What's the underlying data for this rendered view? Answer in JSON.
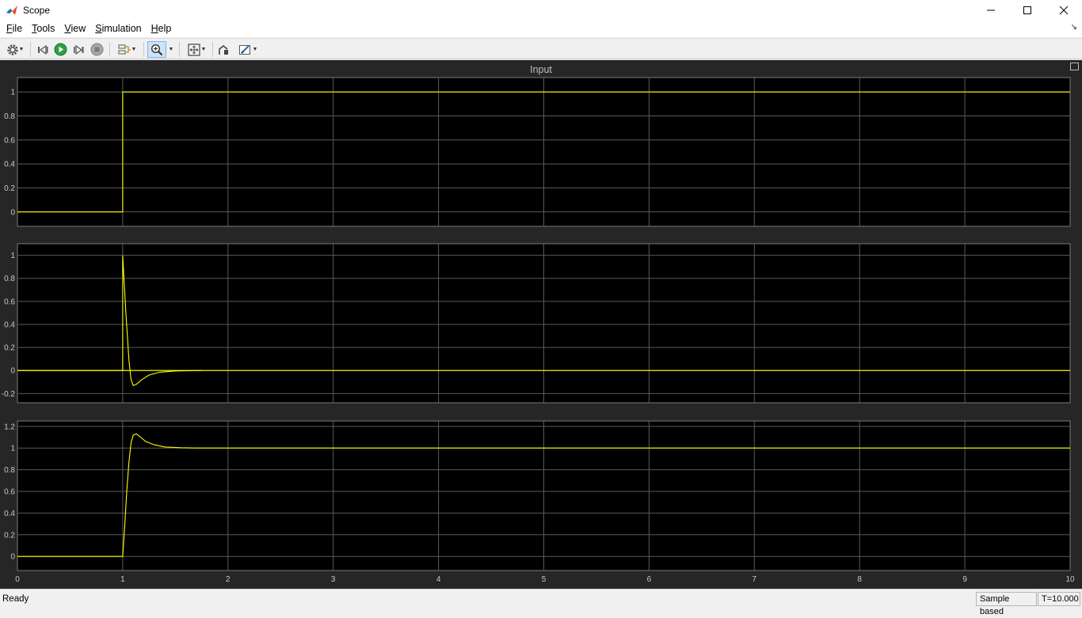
{
  "window": {
    "title": "Scope",
    "icon": "matlab-icon",
    "controls": [
      "minimize-icon",
      "maximize-icon",
      "close-icon"
    ]
  },
  "menu": {
    "items": [
      {
        "label": "File",
        "mnemonic": "F",
        "rest": "ile"
      },
      {
        "label": "Tools",
        "mnemonic": "T",
        "rest": "ools"
      },
      {
        "label": "View",
        "mnemonic": "V",
        "rest": "iew"
      },
      {
        "label": "Simulation",
        "mnemonic": "S",
        "rest": "imulation"
      },
      {
        "label": "Help",
        "mnemonic": "H",
        "rest": "elp"
      }
    ],
    "undock_glyph": "↘"
  },
  "toolbar": {
    "buttons": [
      "settings-icon",
      "step-back-icon",
      "run-icon",
      "step-forward-icon",
      "stop-icon",
      "signal-selection-icon",
      "zoom-in-icon",
      "fit-to-view-icon",
      "highlight-block-icon",
      "style-icon"
    ],
    "active_tool": "zoom-in-icon",
    "colors": {
      "run": "#2ea043",
      "stop": "#8c8c8c"
    }
  },
  "scope": {
    "title": "Input",
    "background": "#262626",
    "axes_background": "#000000",
    "trace_color": "#ffff00",
    "grid_color": "#5a5a5a",
    "x_ticks": [
      "0",
      "1",
      "2",
      "3",
      "4",
      "5",
      "6",
      "7",
      "8",
      "9",
      "10"
    ]
  },
  "chart_data": [
    {
      "type": "line",
      "xlim": [
        0,
        10
      ],
      "ylim": [
        -0.12,
        1.12
      ],
      "yticks": [
        0,
        0.2,
        0.4,
        0.6,
        0.8,
        1
      ],
      "ytick_labels": [
        "0",
        "0.2",
        "0.4",
        "0.6",
        "0.8",
        "1"
      ],
      "grid": true,
      "series": [
        {
          "x": [
            0,
            1,
            1,
            10
          ],
          "y": [
            0,
            0,
            1,
            1
          ]
        }
      ]
    },
    {
      "type": "line",
      "xlim": [
        0,
        10
      ],
      "ylim": [
        -0.28,
        1.1
      ],
      "yticks": [
        -0.2,
        0,
        0.2,
        0.4,
        0.6,
        0.8,
        1
      ],
      "ytick_labels": [
        "-0.2",
        "0",
        "0.2",
        "0.4",
        "0.6",
        "0.8",
        "1"
      ],
      "grid": true,
      "series": [
        {
          "x": [
            0,
            1,
            1,
            1.03,
            1.06,
            1.08,
            1.1,
            1.13,
            1.18,
            1.25,
            1.35,
            1.5,
            1.65,
            1.75
          ],
          "y": [
            0,
            0,
            1.0,
            0.5,
            0.08,
            -0.08,
            -0.13,
            -0.12,
            -0.08,
            -0.04,
            -0.015,
            -0.004,
            -0.001,
            0
          ]
        },
        {
          "x": [
            0,
            10
          ],
          "y": [
            0,
            0
          ]
        }
      ]
    },
    {
      "type": "line",
      "xlim": [
        0,
        10
      ],
      "ylim": [
        -0.13,
        1.25
      ],
      "yticks": [
        0,
        0.2,
        0.4,
        0.6,
        0.8,
        1,
        1.2
      ],
      "ytick_labels": [
        "0",
        "0.2",
        "0.4",
        "0.6",
        "0.8",
        "1",
        "1.2"
      ],
      "grid": true,
      "series": [
        {
          "x": [
            0,
            1,
            1.02,
            1.04,
            1.06,
            1.08,
            1.1,
            1.13,
            1.17,
            1.22,
            1.3,
            1.4,
            1.55,
            1.7,
            10
          ],
          "y": [
            0,
            0,
            0.3,
            0.62,
            0.88,
            1.05,
            1.12,
            1.13,
            1.1,
            1.06,
            1.03,
            1.01,
            1.003,
            1.0,
            1.0
          ]
        }
      ]
    }
  ],
  "status": {
    "text": "Ready",
    "sample_mode": "Sample based",
    "time": "T=10.000"
  }
}
